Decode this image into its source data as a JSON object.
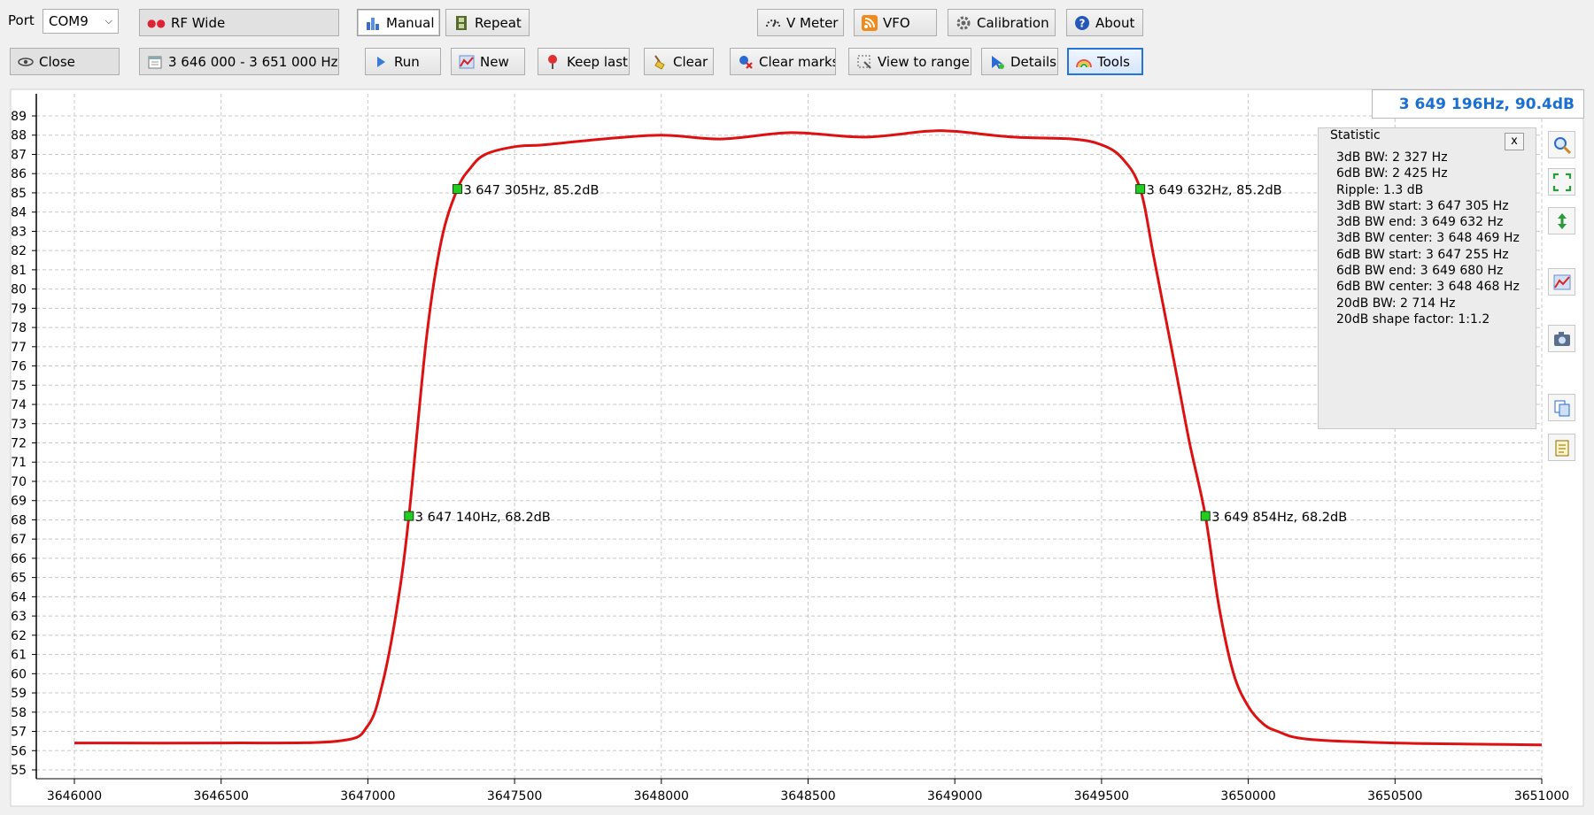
{
  "toolbar": {
    "port_label": "Port",
    "port_value": "COM9",
    "mode": "RF Wide",
    "close": "Close",
    "range": "3 646 000 - 3 651 000 Hz",
    "manual": "Manual",
    "repeat": "Repeat",
    "run": "Run",
    "new": "New",
    "keep_last": "Keep last",
    "clear": "Clear",
    "clear_marks": "Clear marks",
    "view_to_range": "View to range",
    "details": "Details",
    "tools": "Tools",
    "v_meter": "V Meter",
    "vfo": "VFO",
    "calibration": "Calibration",
    "about": "About"
  },
  "readout": "3 649 196Hz, 90.4dB",
  "statistic": {
    "title": "Statistic",
    "close": "x",
    "lines": [
      "3dB BW: 2 327 Hz",
      "6dB BW: 2 425 Hz",
      "Ripple: 1.3 dB",
      "3dB BW start: 3 647 305 Hz",
      "3dB BW end: 3 649 632 Hz",
      "3dB BW center: 3 648 469 Hz",
      "6dB BW start: 3 647 255 Hz",
      "6dB BW end: 3 649 680 Hz",
      "6dB BW center: 3 648 468 Hz",
      "20dB BW: 2 714 Hz",
      "20dB shape factor: 1:1.2"
    ]
  },
  "colors": {
    "trace": "#dd1111",
    "marker": "#22cc22",
    "readout": "#1a6fd1",
    "active_border": "#2a73d6"
  },
  "side_icons": [
    "zoom-icon",
    "fit-view-icon",
    "vertical-scale-icon",
    "chart-icon",
    "camera-icon",
    "copy-icon",
    "export-icon"
  ],
  "chart_data": {
    "type": "line",
    "xlim": [
      3646000,
      3651000
    ],
    "ylim": [
      55,
      89
    ],
    "x_ticks": [
      3646000,
      3646500,
      3647000,
      3647500,
      3648000,
      3648500,
      3649000,
      3649500,
      3650000,
      3650500,
      3651000
    ],
    "y_ticks": [
      55,
      56,
      57,
      58,
      59,
      60,
      61,
      62,
      63,
      64,
      65,
      66,
      67,
      68,
      69,
      70,
      71,
      72,
      73,
      74,
      75,
      76,
      77,
      78,
      79,
      80,
      81,
      82,
      83,
      84,
      85,
      86,
      87,
      88,
      89
    ],
    "grid": true,
    "series": [
      {
        "x": [
          3646000,
          3646500,
          3646900,
          3647000,
          3647050,
          3647100,
          3647140,
          3647200,
          3647250,
          3647305,
          3647350,
          3647400,
          3647500,
          3647600,
          3647800,
          3648000,
          3648200,
          3648400,
          3648500,
          3648700,
          3648900,
          3649000,
          3649200,
          3649400,
          3649500,
          3649570,
          3649632,
          3649680,
          3649750,
          3649800,
          3649854,
          3649900,
          3649950,
          3650000,
          3650050,
          3650100,
          3650200,
          3650500,
          3651000
        ],
        "y": [
          56.4,
          56.4,
          56.5,
          57.3,
          59.5,
          63.5,
          68.2,
          77.5,
          82.5,
          85.2,
          86.3,
          87.0,
          87.4,
          87.5,
          87.8,
          88.0,
          87.8,
          88.1,
          88.1,
          87.9,
          88.2,
          88.2,
          87.9,
          87.8,
          87.5,
          86.8,
          85.2,
          81.5,
          76.0,
          72.0,
          68.2,
          63.5,
          60.0,
          58.3,
          57.4,
          57.0,
          56.6,
          56.4,
          56.3
        ]
      }
    ],
    "markers": [
      {
        "x": 3647305,
        "y": 85.2,
        "label": "3 647 305Hz, 85.2dB"
      },
      {
        "x": 3649632,
        "y": 85.2,
        "label": "3 649 632Hz, 85.2dB"
      },
      {
        "x": 3647140,
        "y": 68.2,
        "label": "3 647 140Hz, 68.2dB"
      },
      {
        "x": 3649854,
        "y": 68.2,
        "label": "3 649 854Hz, 68.2dB"
      }
    ]
  }
}
